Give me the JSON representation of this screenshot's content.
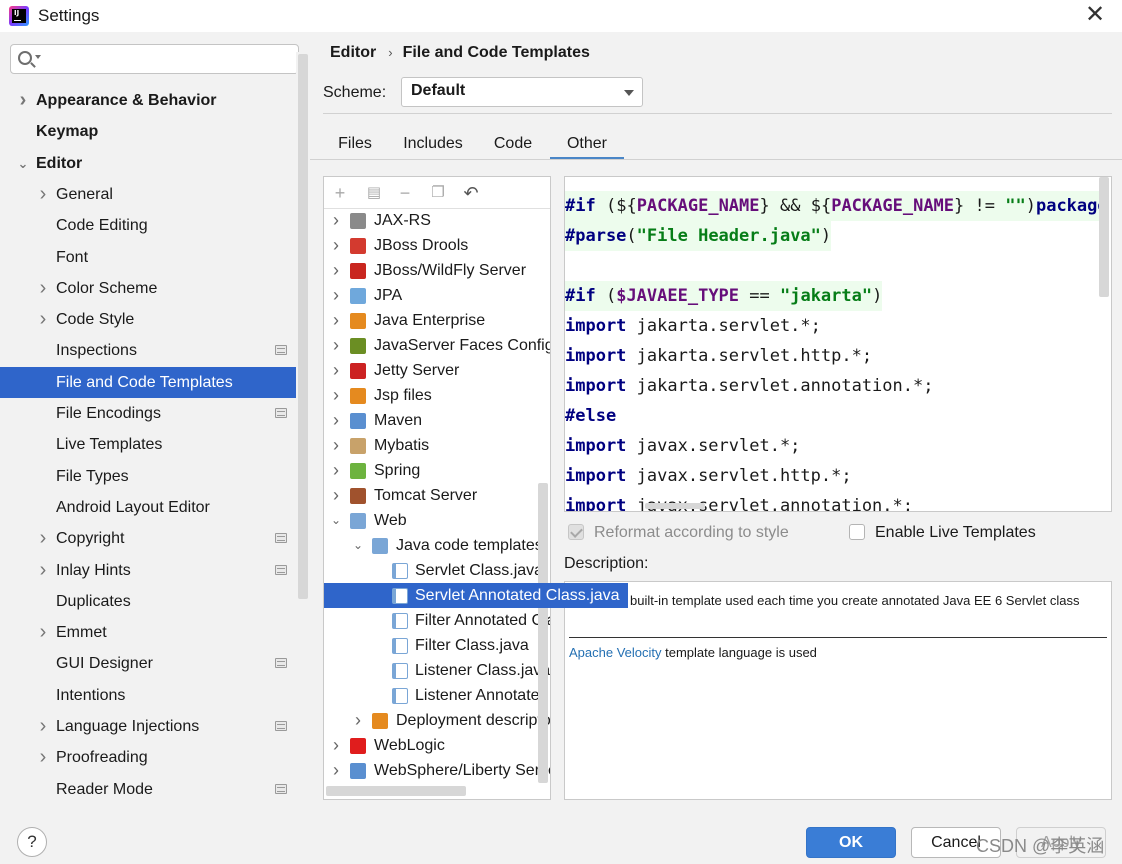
{
  "window": {
    "title": "Settings"
  },
  "search": {
    "placeholder": ""
  },
  "sidebar": {
    "items": [
      {
        "label": "Appearance & Behavior",
        "bold": true,
        "chevron": "right",
        "level": 0
      },
      {
        "label": "Keymap",
        "bold": true,
        "chevron": "",
        "level": 0
      },
      {
        "label": "Editor",
        "bold": true,
        "chevron": "down",
        "level": 0
      },
      {
        "label": "General",
        "chevron": "right",
        "level": 1
      },
      {
        "label": "Code Editing",
        "chevron": "",
        "level": 1
      },
      {
        "label": "Font",
        "chevron": "",
        "level": 1
      },
      {
        "label": "Color Scheme",
        "chevron": "right",
        "level": 1
      },
      {
        "label": "Code Style",
        "chevron": "right",
        "level": 1
      },
      {
        "label": "Inspections",
        "chevron": "",
        "level": 1,
        "project_icon": true
      },
      {
        "label": "File and Code Templates",
        "chevron": "",
        "level": 1,
        "selected": true
      },
      {
        "label": "File Encodings",
        "chevron": "",
        "level": 1,
        "project_icon": true
      },
      {
        "label": "Live Templates",
        "chevron": "",
        "level": 1
      },
      {
        "label": "File Types",
        "chevron": "",
        "level": 1
      },
      {
        "label": "Android Layout Editor",
        "chevron": "",
        "level": 1
      },
      {
        "label": "Copyright",
        "chevron": "right",
        "level": 1,
        "project_icon": true
      },
      {
        "label": "Inlay Hints",
        "chevron": "right",
        "level": 1,
        "project_icon": true
      },
      {
        "label": "Duplicates",
        "chevron": "",
        "level": 1
      },
      {
        "label": "Emmet",
        "chevron": "right",
        "level": 1
      },
      {
        "label": "GUI Designer",
        "chevron": "",
        "level": 1,
        "project_icon": true
      },
      {
        "label": "Intentions",
        "chevron": "",
        "level": 1
      },
      {
        "label": "Language Injections",
        "chevron": "right",
        "level": 1,
        "project_icon": true
      },
      {
        "label": "Proofreading",
        "chevron": "right",
        "level": 1
      },
      {
        "label": "Reader Mode",
        "chevron": "",
        "level": 1,
        "project_icon": true
      }
    ]
  },
  "breadcrumb": {
    "parent": "Editor",
    "current": "File and Code Templates"
  },
  "scheme": {
    "label": "Scheme:",
    "value": "Default"
  },
  "tabs": [
    {
      "label": "Files"
    },
    {
      "label": "Includes"
    },
    {
      "label": "Code"
    },
    {
      "label": "Other",
      "active": true
    }
  ],
  "template_tree": {
    "items": [
      {
        "label": "JAX-RS",
        "level": 0,
        "chevron": "right",
        "icon": "jaxrs-globe-icon",
        "color": "#8a8a8a"
      },
      {
        "label": "JBoss Drools",
        "level": 0,
        "chevron": "right",
        "icon": "jboss-drools-icon",
        "color": "#d33a2f"
      },
      {
        "label": "JBoss/WildFly Server",
        "level": 0,
        "chevron": "right",
        "icon": "wildfly-icon",
        "color": "#c9261f"
      },
      {
        "label": "JPA",
        "level": 0,
        "chevron": "right",
        "icon": "jpa-icon",
        "color": "#6fa8dc"
      },
      {
        "label": "Java Enterprise",
        "level": 0,
        "chevron": "right",
        "icon": "java-enterprise-icon",
        "color": "#e58a1f"
      },
      {
        "label": "JavaServer Faces Configuration",
        "level": 0,
        "chevron": "right",
        "icon": "jsf-icon",
        "color": "#6b8e23"
      },
      {
        "label": "Jetty Server",
        "level": 0,
        "chevron": "right",
        "icon": "jetty-icon",
        "color": "#cc2222"
      },
      {
        "label": "Jsp files",
        "level": 0,
        "chevron": "right",
        "icon": "jsp-icon",
        "color": "#e58a1f"
      },
      {
        "label": "Maven",
        "level": 0,
        "chevron": "right",
        "icon": "maven-icon",
        "color": "#5a8fd0"
      },
      {
        "label": "Mybatis",
        "level": 0,
        "chevron": "right",
        "icon": "mybatis-icon",
        "color": "#c8a26a"
      },
      {
        "label": "Spring",
        "level": 0,
        "chevron": "right",
        "icon": "spring-leaf-icon",
        "color": "#6db33f"
      },
      {
        "label": "Tomcat Server",
        "level": 0,
        "chevron": "right",
        "icon": "tomcat-icon",
        "color": "#a0522d"
      },
      {
        "label": "Web",
        "level": 0,
        "chevron": "down",
        "icon": "web-folder-icon",
        "color": "#7aa6d6"
      },
      {
        "label": "Java code templates",
        "level": 1,
        "chevron": "down",
        "icon": "java-folder-icon",
        "color": "#7aa6d6"
      },
      {
        "label": "Servlet Class.java",
        "level": 2,
        "chevron": "",
        "icon": "java-file-icon",
        "color": "#7aa6d6"
      },
      {
        "label": "Servlet Annotated Class.java",
        "level": 2,
        "chevron": "",
        "icon": "java-file-icon",
        "color": "#7aa6d6",
        "selected": true
      },
      {
        "label": "Filter Annotated Class.java",
        "level": 2,
        "chevron": "",
        "icon": "java-file-icon",
        "color": "#7aa6d6"
      },
      {
        "label": "Filter Class.java",
        "level": 2,
        "chevron": "",
        "icon": "java-file-icon",
        "color": "#7aa6d6"
      },
      {
        "label": "Listener Class.java",
        "level": 2,
        "chevron": "",
        "icon": "java-file-icon",
        "color": "#7aa6d6"
      },
      {
        "label": "Listener Annotated Class.java",
        "level": 2,
        "chevron": "",
        "icon": "java-file-icon",
        "color": "#7aa6d6"
      },
      {
        "label": "Deployment descriptors",
        "level": 1,
        "chevron": "right",
        "icon": "xml-folder-icon",
        "color": "#e58a1f"
      },
      {
        "label": "WebLogic",
        "level": 0,
        "chevron": "right",
        "icon": "weblogic-icon",
        "color": "#e01d1d"
      },
      {
        "label": "WebSphere/Liberty Server",
        "level": 0,
        "chevron": "right",
        "icon": "websphere-icon",
        "color": "#5a8fd0"
      }
    ]
  },
  "code_lines": [
    [
      {
        "t": "#if",
        "c": "kw"
      },
      {
        "t": " (",
        "c": ""
      },
      {
        "t": "${",
        "c": ""
      },
      {
        "t": "PACKAGE_NAME",
        "c": "vl"
      },
      {
        "t": "}",
        "c": ""
      },
      {
        "t": " && ",
        "c": ""
      },
      {
        "t": "${",
        "c": ""
      },
      {
        "t": "PACKAGE_NAME",
        "c": "vl"
      },
      {
        "t": "}",
        "c": ""
      },
      {
        "t": " != ",
        "c": ""
      },
      {
        "t": "\"\"",
        "c": "st"
      },
      {
        "t": ")",
        "c": ""
      },
      {
        "t": "package",
        "c": "kw"
      }
    ],
    [
      {
        "t": "#parse",
        "c": "kw"
      },
      {
        "t": "(",
        "c": ""
      },
      {
        "t": "\"File Header.java\"",
        "c": "st"
      },
      {
        "t": ")",
        "c": ""
      }
    ],
    [],
    [
      {
        "t": "#if",
        "c": "kw"
      },
      {
        "t": " (",
        "c": ""
      },
      {
        "t": "$JAVAEE_TYPE",
        "c": "vl"
      },
      {
        "t": " == ",
        "c": ""
      },
      {
        "t": "\"jakarta\"",
        "c": "st"
      },
      {
        "t": ")",
        "c": ""
      }
    ],
    [
      {
        "t": "import",
        "c": "kw"
      },
      {
        "t": " jakarta.servlet.*;",
        "c": ""
      }
    ],
    [
      {
        "t": "import",
        "c": "kw"
      },
      {
        "t": " jakarta.servlet.http.*;",
        "c": ""
      }
    ],
    [
      {
        "t": "import",
        "c": "kw"
      },
      {
        "t": " jakarta.servlet.annotation.*;",
        "c": ""
      }
    ],
    [
      {
        "t": "#else",
        "c": "kw"
      }
    ],
    [
      {
        "t": "import",
        "c": "kw"
      },
      {
        "t": " javax.servlet.*;",
        "c": ""
      }
    ],
    [
      {
        "t": "import",
        "c": "kw"
      },
      {
        "t": " javax.servlet.http.*;",
        "c": ""
      }
    ],
    [
      {
        "t": "import",
        "c": "kw"
      },
      {
        "t": " javax.servlet.annotation.*;",
        "c": ""
      }
    ]
  ],
  "options": {
    "reformat_label": "Reformat according to style",
    "reformat_checked": true,
    "live_templates_label": "Enable Live Templates",
    "live_templates_checked": false
  },
  "description": {
    "label": "Description:",
    "text": "built-in template used each time you create annotated Java EE 6 Servlet class",
    "velocity_link": "Apache Velocity",
    "velocity_suffix": " template language is used"
  },
  "buttons": {
    "ok": "OK",
    "cancel": "Cancel",
    "apply": "Apply"
  },
  "watermark": "CSDN @李英涵"
}
